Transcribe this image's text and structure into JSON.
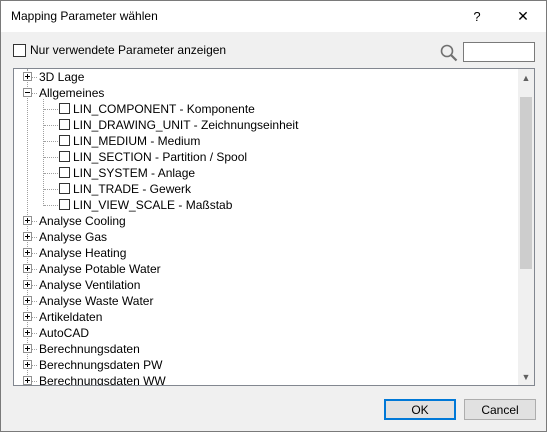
{
  "window": {
    "title": "Mapping Parameter wählen",
    "help_label": "?",
    "close_label": "✕"
  },
  "filter": {
    "checkbox_label": "Nur verwendete Parameter anzeigen",
    "checked": false,
    "search_value": "",
    "search_icon": "magnifier-icon"
  },
  "tree": {
    "items": [
      {
        "label": "3D Lage"
      },
      {
        "label": "Allgemeines"
      },
      {
        "label": "LIN_COMPONENT - Komponente"
      },
      {
        "label": "LIN_DRAWING_UNIT - Zeichnungseinheit"
      },
      {
        "label": "LIN_MEDIUM - Medium"
      },
      {
        "label": "LIN_SECTION - Partition / Spool"
      },
      {
        "label": "LIN_SYSTEM - Anlage"
      },
      {
        "label": "LIN_TRADE - Gewerk"
      },
      {
        "label": "LIN_VIEW_SCALE - Maßstab"
      },
      {
        "label": "Analyse Cooling"
      },
      {
        "label": "Analyse Gas"
      },
      {
        "label": "Analyse Heating"
      },
      {
        "label": "Analyse Potable Water"
      },
      {
        "label": "Analyse Ventilation"
      },
      {
        "label": "Analyse Waste Water"
      },
      {
        "label": "Artikeldaten"
      },
      {
        "label": "AutoCAD"
      },
      {
        "label": "Berechnungsdaten"
      },
      {
        "label": "Berechnungsdaten PW"
      },
      {
        "label": "Berechnungsdaten WW"
      }
    ]
  },
  "buttons": {
    "ok": "OK",
    "cancel": "Cancel"
  },
  "colors": {
    "accent": "#0078d7",
    "dialog_bg": "#f0f0f0"
  }
}
